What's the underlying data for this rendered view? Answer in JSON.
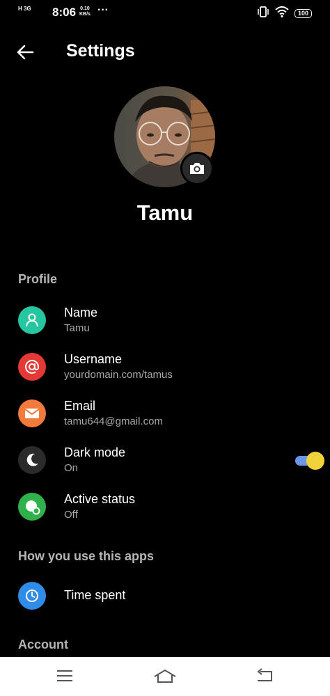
{
  "status": {
    "network": "H 3G",
    "time": "8:06",
    "speed_value": "0.10",
    "speed_unit": "KB/s",
    "dots": "···",
    "battery": "100"
  },
  "header": {
    "title": "Settings"
  },
  "profile": {
    "display_name": "Tamu"
  },
  "sections": {
    "profile": "Profile",
    "usage": "How you use this apps",
    "account": "Account"
  },
  "rows": {
    "name": {
      "label": "Name",
      "value": "Tamu",
      "color": "#26c6a1"
    },
    "username": {
      "label": "Username",
      "value": "yourdomain.com/tamus",
      "color": "#e53935"
    },
    "email": {
      "label": "Email",
      "value": "tamu644@gmail.com",
      "color": "#f27a3a"
    },
    "dark_mode": {
      "label": "Dark mode",
      "value": "On",
      "color": "#2b2b2b"
    },
    "active_status": {
      "label": "Active status",
      "value": "Off",
      "color": "#2fb24c"
    },
    "time_spent": {
      "label": "Time spent",
      "color": "#2f8ce8"
    }
  },
  "toggle": {
    "dark_mode_on": true,
    "track_color": "#6c96e8",
    "knob_color": "#f2d23a"
  }
}
